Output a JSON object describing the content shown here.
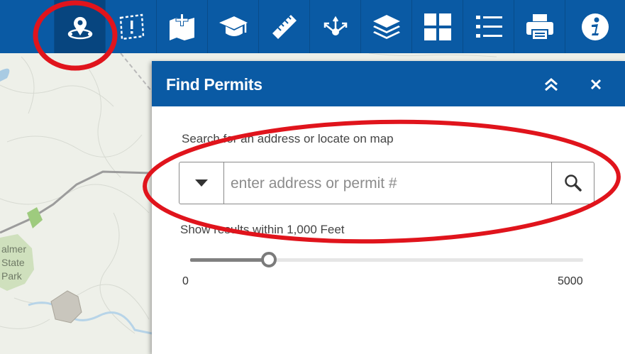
{
  "map": {
    "labels": [
      "almer",
      "State",
      "Park"
    ]
  },
  "toolbar": {
    "tools": [
      {
        "name": "find-permits",
        "icon": "location-pin-icon"
      },
      {
        "name": "select-area",
        "icon": "dashed-alert-icon"
      },
      {
        "name": "add-map",
        "icon": "map-plus-icon"
      },
      {
        "name": "tutorial",
        "icon": "graduation-cap-icon"
      },
      {
        "name": "measure",
        "icon": "ruler-icon"
      },
      {
        "name": "share",
        "icon": "share-network-icon"
      },
      {
        "name": "layers",
        "icon": "layers-icon"
      },
      {
        "name": "basemap-gallery",
        "icon": "grid-icon"
      },
      {
        "name": "legend",
        "icon": "list-icon"
      },
      {
        "name": "print",
        "icon": "printer-icon"
      },
      {
        "name": "about",
        "icon": "info-icon"
      }
    ],
    "active_tool": "find-permits"
  },
  "panel": {
    "title": "Find Permits",
    "instruction": "Search for an address or locate on map",
    "search": {
      "placeholder": "enter address or permit #",
      "value": ""
    },
    "distance": {
      "label": "Show results within 1,000 Feet",
      "value": 1000,
      "min": 0,
      "max": 5000,
      "min_label": "0",
      "max_label": "5000"
    }
  },
  "colors": {
    "header_blue": "#0a5aa4",
    "annotation_red": "#e0141c"
  }
}
